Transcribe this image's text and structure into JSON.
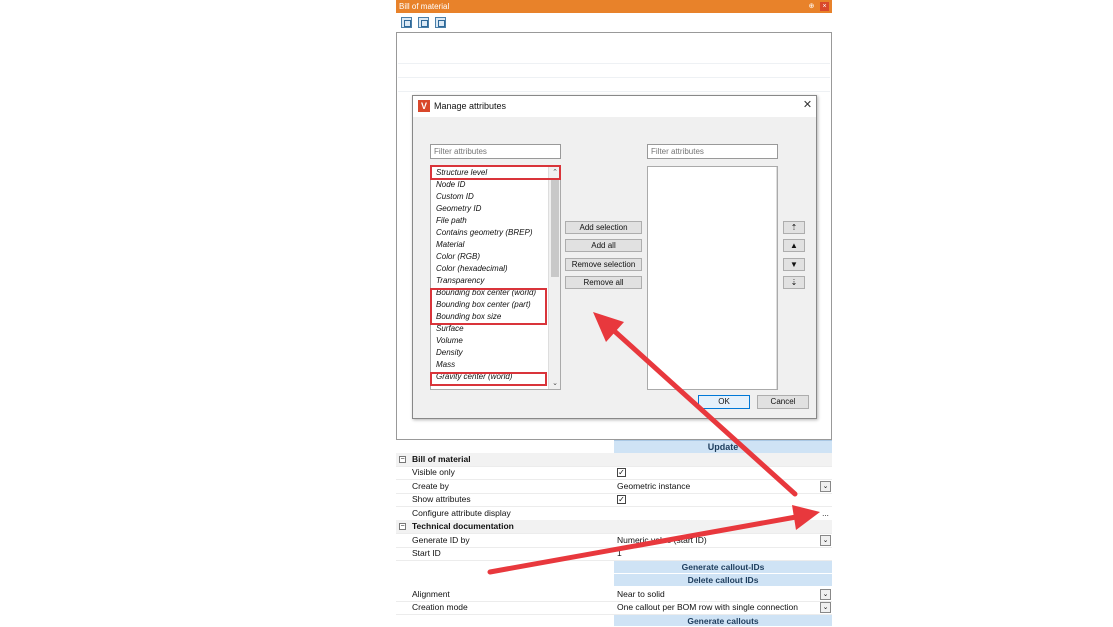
{
  "window": {
    "title": "Bill of material",
    "pin_glyph": "⊕",
    "close_glyph": "×",
    "toolbar_icons": [
      "copy-icon",
      "refresh-icon",
      "fit-icon"
    ]
  },
  "dialog": {
    "title": "Manage attributes",
    "logo_glyph": "V",
    "close_glyph": "✕",
    "left_filter_placeholder": "Filter attributes",
    "right_filter_placeholder": "Filter attributes",
    "available_attributes": [
      "Structure level",
      "Node ID",
      "Custom ID",
      "Geometry ID",
      "File path",
      "Contains geometry (BREP)",
      "Material",
      "Color (RGB)",
      "Color (hexadecimal)",
      "Transparency",
      "Bounding box center (world)",
      "Bounding box center (part)",
      "Bounding box size",
      "Surface",
      "Volume",
      "Density",
      "Mass",
      "Gravity center (world)"
    ],
    "selected_attributes": [],
    "buttons": {
      "add_selection": "Add selection",
      "add_all": "Add all",
      "remove_selection": "Remove selection",
      "remove_all": "Remove all",
      "ok": "OK",
      "cancel": "Cancel"
    },
    "side_buttons": [
      "⇡",
      "▲",
      "▼",
      "⇣"
    ],
    "scroll_up": "⌃",
    "scroll_down": "⌄"
  },
  "properties": {
    "update_label": "Update",
    "section_bom": "Bill of material",
    "section_tech": "Technical documentation",
    "collapse_glyph": "−",
    "check_glyph": "✓",
    "dropdown_glyph": "⌄",
    "ellipsis": "...",
    "visible_only": {
      "label": "Visible only",
      "checked": true
    },
    "create_by": {
      "label": "Create by",
      "value": "Geometric instance"
    },
    "show_attributes": {
      "label": "Show attributes",
      "checked": true
    },
    "configure_display": {
      "label": "Configure attribute display"
    },
    "generate_id_by": {
      "label": "Generate ID by",
      "value": "Numeric value (start ID)"
    },
    "start_id": {
      "label": "Start ID",
      "value": "1"
    },
    "generate_callout_ids": "Generate callout-IDs",
    "delete_callout_ids": "Delete callout IDs",
    "alignment": {
      "label": "Alignment",
      "value": "Near to solid"
    },
    "creation_mode": {
      "label": "Creation mode",
      "value": "One callout per BOM row with single connection"
    },
    "generate_callouts": "Generate callouts"
  },
  "colors": {
    "titlebar": "#e8822a",
    "highlight": "#d9343a",
    "action_row": "#cfe3f5"
  }
}
